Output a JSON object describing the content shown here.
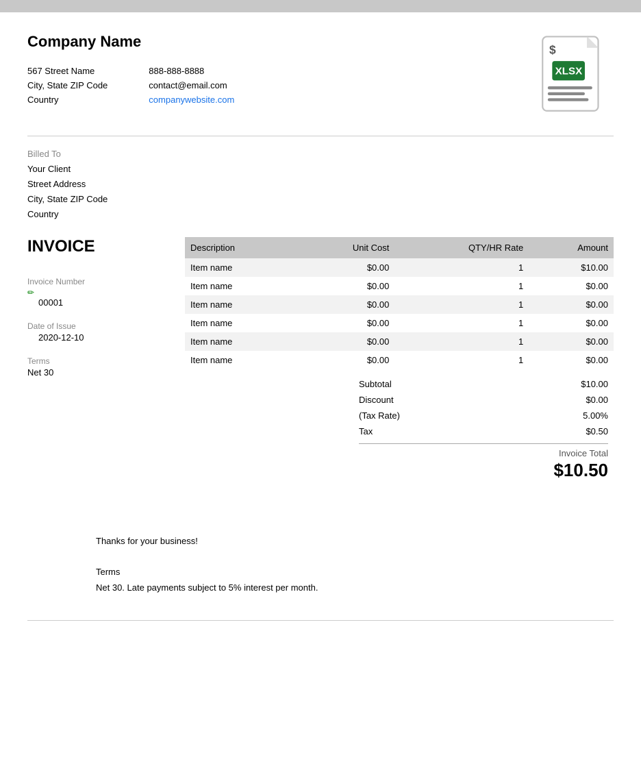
{
  "topbar": {},
  "header": {
    "company_name": "Company Name",
    "address_line1": "567 Street Name",
    "address_line2": "City, State ZIP Code",
    "address_line3": "Country",
    "phone": "888-888-8888",
    "email": "contact@email.com",
    "website": "companywebsite.com",
    "website_href": "#"
  },
  "billed_to": {
    "label": "Billed To",
    "client": "Your Client",
    "street": "Street Address",
    "city": "City, State ZIP Code",
    "country": "Country"
  },
  "invoice": {
    "heading": "INVOICE",
    "number_label": "Invoice Number",
    "number_mark": "✏",
    "number_value": "00001",
    "date_label": "Date of Issue",
    "date_value": "2020-12-10",
    "terms_label": "Terms",
    "terms_value": "Net 30"
  },
  "table": {
    "headers": [
      "Description",
      "Unit Cost",
      "QTY/HR Rate",
      "Amount"
    ],
    "rows": [
      {
        "description": "Item name",
        "unit_cost": "$0.00",
        "qty": "1",
        "amount": "$10.00"
      },
      {
        "description": "Item name",
        "unit_cost": "$0.00",
        "qty": "1",
        "amount": "$0.00"
      },
      {
        "description": "Item name",
        "unit_cost": "$0.00",
        "qty": "1",
        "amount": "$0.00"
      },
      {
        "description": "Item name",
        "unit_cost": "$0.00",
        "qty": "1",
        "amount": "$0.00"
      },
      {
        "description": "Item name",
        "unit_cost": "$0.00",
        "qty": "1",
        "amount": "$0.00"
      },
      {
        "description": "Item name",
        "unit_cost": "$0.00",
        "qty": "1",
        "amount": "$0.00"
      }
    ]
  },
  "summary": {
    "subtotal_label": "Subtotal",
    "subtotal_value": "$10.00",
    "discount_label": "Discount",
    "discount_value": "$0.00",
    "tax_rate_label": "(Tax Rate)",
    "tax_rate_value": "5.00%",
    "tax_label": "Tax",
    "tax_value": "$0.50",
    "total_label": "Invoice Total",
    "total_value": "$10.50"
  },
  "footer": {
    "thanks": "Thanks for your business!",
    "terms_label": "Terms",
    "terms_text": "Net 30. Late payments subject to 5% interest per month."
  }
}
